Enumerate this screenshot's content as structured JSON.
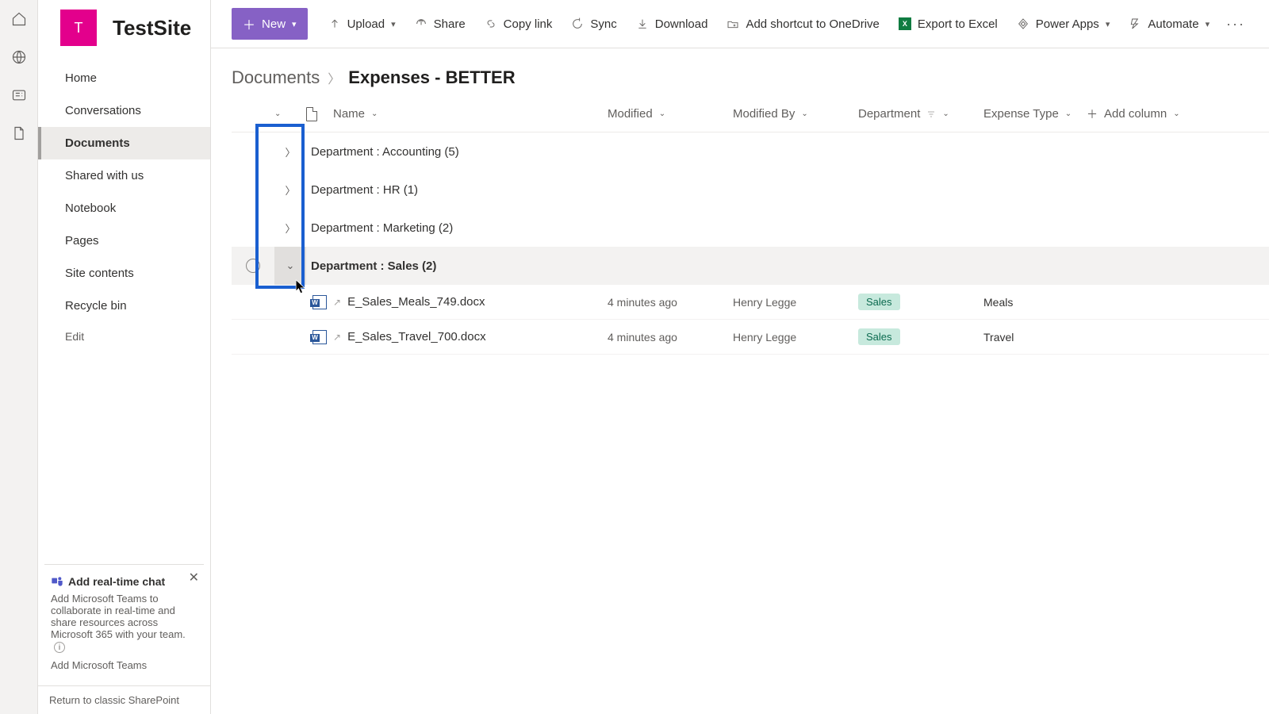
{
  "site": {
    "logo_letter": "T",
    "title": "TestSite"
  },
  "nav": {
    "items": [
      "Home",
      "Conversations",
      "Documents",
      "Shared with us",
      "Notebook",
      "Pages",
      "Site contents",
      "Recycle bin",
      "Edit"
    ],
    "active_index": 2
  },
  "chat_card": {
    "title": "Add real-time chat",
    "body": "Add Microsoft Teams to collaborate in real-time and share resources across Microsoft 365 with your team.",
    "link": "Add Microsoft Teams"
  },
  "classic_link": "Return to classic SharePoint",
  "cmdbar": {
    "new": "New",
    "upload": "Upload",
    "share": "Share",
    "copylink": "Copy link",
    "sync": "Sync",
    "download": "Download",
    "shortcut": "Add shortcut to OneDrive",
    "export": "Export to Excel",
    "powerapps": "Power Apps",
    "automate": "Automate"
  },
  "breadcrumb": {
    "root": "Documents",
    "current": "Expenses - BETTER"
  },
  "columns": {
    "name": "Name",
    "modified": "Modified",
    "modified_by": "Modified By",
    "department": "Department",
    "expense_type": "Expense Type",
    "add": "Add column"
  },
  "groups": [
    {
      "label": "Department : Accounting (5)",
      "expanded": false
    },
    {
      "label": "Department : HR (1)",
      "expanded": false
    },
    {
      "label": "Department : Marketing (2)",
      "expanded": false
    },
    {
      "label": "Department : Sales (2)",
      "expanded": true
    }
  ],
  "rows": [
    {
      "name": "E_Sales_Meals_749.docx",
      "modified": "4 minutes ago",
      "by": "Henry Legge",
      "dept": "Sales",
      "etype": "Meals"
    },
    {
      "name": "E_Sales_Travel_700.docx",
      "modified": "4 minutes ago",
      "by": "Henry Legge",
      "dept": "Sales",
      "etype": "Travel"
    }
  ]
}
